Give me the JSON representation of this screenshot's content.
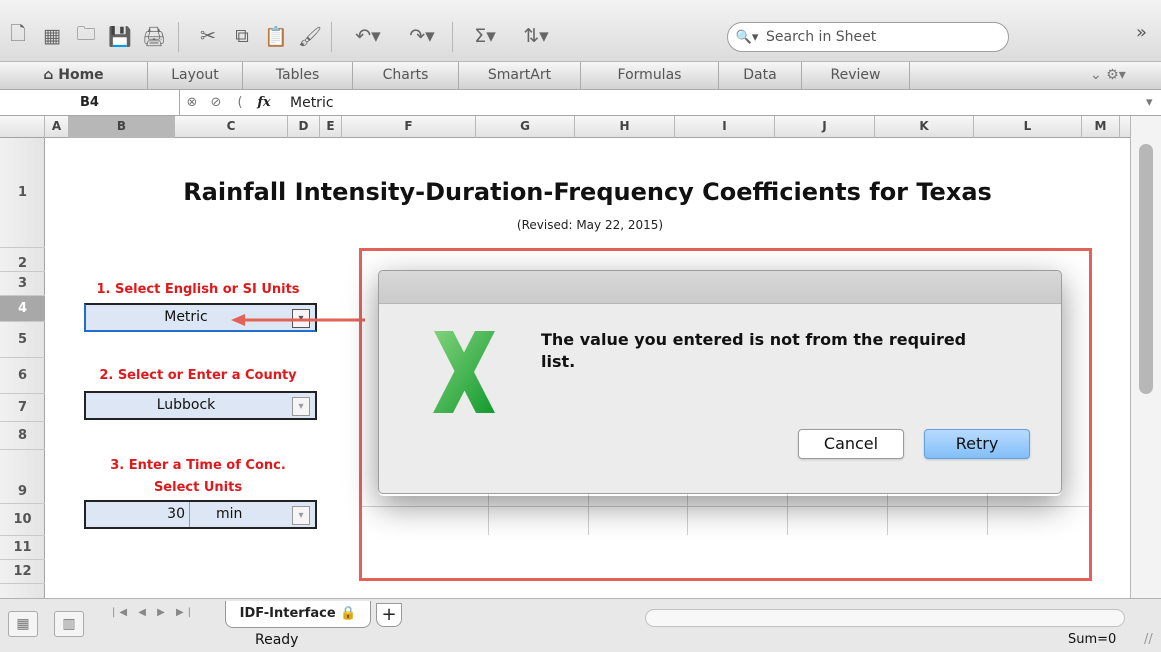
{
  "toolbar": {
    "icons": [
      "new-icon",
      "templates-icon",
      "open-icon",
      "save-icon",
      "print-icon",
      "cut-icon",
      "copy-icon",
      "paste-icon",
      "format-painter-icon",
      "undo-icon",
      "redo-icon",
      "autosum-icon",
      "sort-icon"
    ],
    "search_placeholder": "Search in Sheet"
  },
  "ribbon": {
    "tabs": [
      "Home",
      "Layout",
      "Tables",
      "Charts",
      "SmartArt",
      "Formulas",
      "Data",
      "Review"
    ]
  },
  "formula_bar": {
    "cell_reference": "B4",
    "formula_value": "Metric"
  },
  "columns": [
    "A",
    "B",
    "C",
    "D",
    "E",
    "F",
    "G",
    "H",
    "I",
    "J",
    "K",
    "L",
    "M"
  ],
  "rows": [
    "1",
    "2",
    "3",
    "4",
    "5",
    "6",
    "7",
    "8",
    "9",
    "10",
    "11",
    "12"
  ],
  "sheet": {
    "title": "Rainfall Intensity-Duration-Frequency Coefficients for Texas",
    "revised": "(Revised: May 22, 2015)",
    "step1": "1. Select English or SI Units",
    "units_value": "Metric",
    "step2": "2. Select or Enter a County",
    "county_value": "Lubbock",
    "step3_line1": "3. Enter a Time of Conc.",
    "step3_line2": "Select Units",
    "time_value": "30",
    "time_unit": "min"
  },
  "dialog": {
    "message": "The value you entered is not from the required list.",
    "cancel_label": "Cancel",
    "retry_label": "Retry"
  },
  "bottom_bar": {
    "sheet_tab": "IDF-Interface",
    "add_tab_label": "+",
    "status": "Ready",
    "sum_display": "Sum=0"
  },
  "colors": {
    "callout_border": "#e36258",
    "label_red": "#e0191c",
    "selected_cell": "#dce6f4",
    "retry_button": "#82bef8"
  }
}
